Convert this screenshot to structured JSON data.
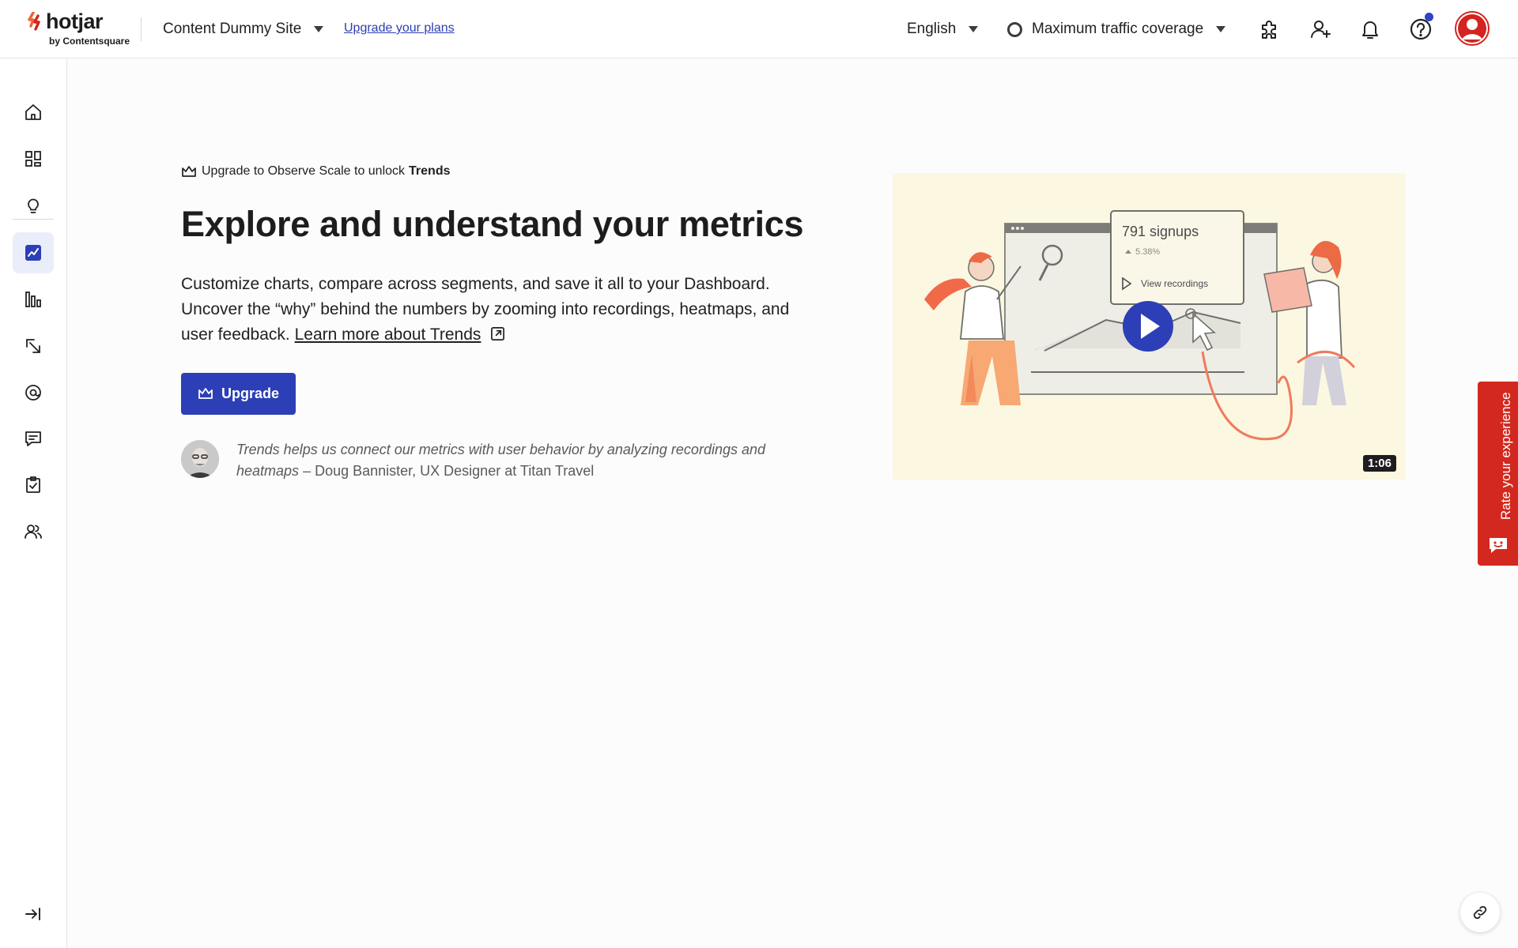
{
  "brand": {
    "logo_text": "hotjar",
    "logo_sub": "by Contentsquare"
  },
  "header": {
    "site_name": "Content Dummy Site",
    "upgrade_plans": "Upgrade your plans",
    "language": "English",
    "traffic": "Maximum traffic coverage",
    "icons": [
      "puzzle-icon",
      "add-user-icon",
      "bell-icon",
      "help-icon",
      "user-avatar-icon"
    ]
  },
  "sidebar": {
    "items": [
      {
        "icon": "home-icon"
      },
      {
        "icon": "dashboard-icon"
      },
      {
        "icon": "lightbulb-icon"
      },
      {
        "icon": "trends-icon",
        "active": true
      },
      {
        "icon": "funnels-icon"
      },
      {
        "icon": "heatmaps-icon"
      },
      {
        "icon": "recordings-icon"
      },
      {
        "icon": "feedback-icon"
      },
      {
        "icon": "surveys-icon"
      },
      {
        "icon": "interviews-icon"
      }
    ],
    "collapse_icon": "collapse-sidebar-icon"
  },
  "main": {
    "eyebrow_prefix": "Upgrade to Observe Scale to unlock",
    "eyebrow_bold": "Trends",
    "title": "Explore and understand your metrics",
    "description": "Customize charts, compare across segments, and save it all to your Dashboard. Uncover the “why” behind the numbers by zooming into recordings, heatmaps, and user feedback.",
    "learn_more": "Learn more about Trends",
    "upgrade_button": "Upgrade",
    "quote_text": "Trends helps us connect our metrics with user behavior by analyzing recordings and heatmaps",
    "quote_author": " – Doug Bannister, UX Designer at Titan Travel"
  },
  "video": {
    "signups": "791 signups",
    "change": "5.38%",
    "view_recordings": "View recordings",
    "duration": "1:06"
  },
  "rate_tab": {
    "label": "Rate your experience"
  },
  "colors": {
    "primary": "#2c3fb6",
    "brand_red": "#d3281f",
    "video_bg": "#fbf7e1",
    "notif_dot": "#2f43c7"
  }
}
